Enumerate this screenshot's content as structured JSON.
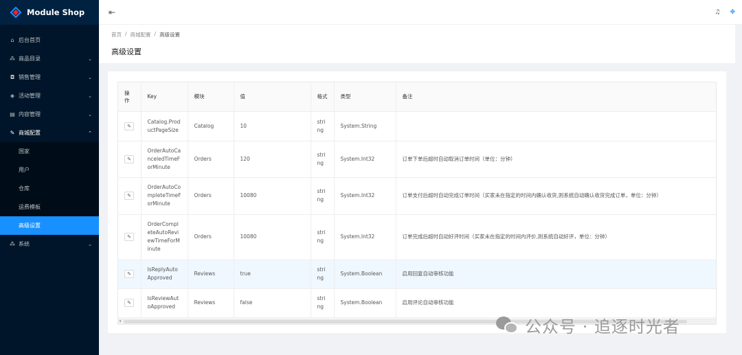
{
  "app": {
    "title": "Module Shop"
  },
  "sidebar": {
    "items": [
      {
        "label": "后台首页",
        "icon": "home-icon",
        "glyph": "⌂"
      },
      {
        "label": "商品目录",
        "icon": "cluster-icon",
        "glyph": "⁂",
        "chevron": "⌄"
      },
      {
        "label": "销售管理",
        "icon": "shopping-cart-icon",
        "glyph": "◘",
        "chevron": "⌄"
      },
      {
        "label": "活动管理",
        "icon": "tag-icon",
        "glyph": "◈",
        "chevron": "⌄"
      },
      {
        "label": "内容管理",
        "icon": "profile-icon",
        "glyph": "▤",
        "chevron": "⌄"
      },
      {
        "label": "商城配置",
        "icon": "tool-icon",
        "glyph": "✎",
        "chevron": "⌃"
      }
    ],
    "sub_items": [
      "国家",
      "用户",
      "仓库",
      "运费模板",
      "高级设置"
    ],
    "system": {
      "label": "系统",
      "icon": "apartment-icon",
      "glyph": "⁂",
      "chevron": "⌄"
    }
  },
  "header": {
    "fold_icon": "menu-fold-icon",
    "bell_icon": "bell-icon",
    "drag_icon": "drag-icon"
  },
  "breadcrumb": [
    "首页",
    "商城配置",
    "高级设置"
  ],
  "page_title": "高级设置",
  "table": {
    "headers": [
      "操作",
      "Key",
      "模块",
      "值",
      "格式",
      "类型",
      "备注"
    ],
    "rows": [
      {
        "key": "Catalog.ProductPageSize",
        "module": "Catalog",
        "value": "10",
        "format": "string",
        "type": "System.String",
        "note": ""
      },
      {
        "key": "OrderAutoCanceledTimeForMinute",
        "module": "Orders",
        "value": "120",
        "format": "string",
        "type": "System.Int32",
        "note": "订单下单后超时自动取消订单时间（单位：分钟）"
      },
      {
        "key": "OrderAutoCompleteTimeForMinute",
        "module": "Orders",
        "value": "10080",
        "format": "string",
        "type": "System.Int32",
        "note": "订单支付后超时自动完成订单时间（买家未在指定的时间内确认收货,则系统自动确认收货完成订单，单位：分钟）"
      },
      {
        "key": "OrderCompleteAutoReviewTimeForMinute",
        "module": "Orders",
        "value": "10080",
        "format": "string",
        "type": "System.Int32",
        "note": "订单完成后超时自动好评时间（买家未在指定的时间内评价,则系统自动好评，单位：分钟）"
      },
      {
        "key": "IsReplyAutoApproved",
        "module": "Reviews",
        "value": "true",
        "format": "string",
        "type": "System.Boolean",
        "note": "启用回复自动审核功能"
      },
      {
        "key": "IsReviewAutoApproved",
        "module": "Reviews",
        "value": "false",
        "format": "string",
        "type": "System.Boolean",
        "note": "启用评论自动审核功能"
      }
    ]
  },
  "watermark": {
    "text": "公众号 · 追逐时光者"
  }
}
